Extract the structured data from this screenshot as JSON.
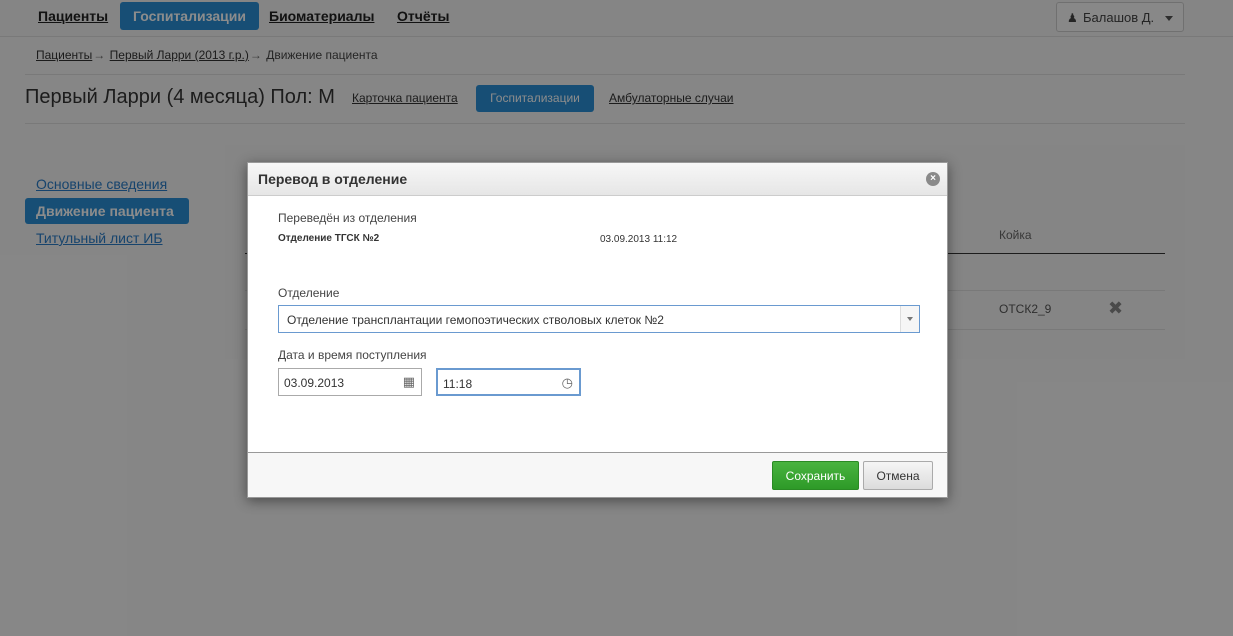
{
  "nav": {
    "items": [
      {
        "label": "Пациенты",
        "active": false
      },
      {
        "label": "Госпитализации",
        "active": true
      },
      {
        "label": "Биоматериалы",
        "active": false
      },
      {
        "label": "Отчёты",
        "active": false
      }
    ],
    "user_label": "Балашов Д."
  },
  "breadcrumb": {
    "items": [
      "Пациенты",
      "Первый Ларри (2013 г.р.)",
      "Движение пациента"
    ],
    "separator": "→"
  },
  "patient": {
    "title": "Первый Ларри (4 месяца) Пол: М",
    "tabs": [
      {
        "label": "Карточка пациента"
      },
      {
        "label": "Госпитализации"
      },
      {
        "label": "Амбулаторные случаи"
      }
    ]
  },
  "side_menu": {
    "items": [
      {
        "label": "Основные сведения"
      },
      {
        "label": "Движение пациента"
      },
      {
        "label": "Титульный лист ИБ"
      }
    ]
  },
  "table": {
    "column_bed": "Койка",
    "row_bed": "ОТСК2_9"
  },
  "modal": {
    "title": "Перевод в отделение",
    "transferred_from_label": "Переведён из отделения",
    "from_department": "Отделение ТГСК №2",
    "from_datetime": "03.09.2013 11:12",
    "department_label": "Отделение",
    "department_value": "Отделение трансплантации гемопоэтических стволовых клеток №2",
    "admission_label": "Дата и время поступления",
    "date_value": "03.09.2013",
    "time_value": "11:18",
    "save_label": "Сохранить",
    "cancel_label": "Отмена"
  },
  "colors": {
    "accent": "#2a8fd6",
    "save_button": "#3aa632"
  }
}
